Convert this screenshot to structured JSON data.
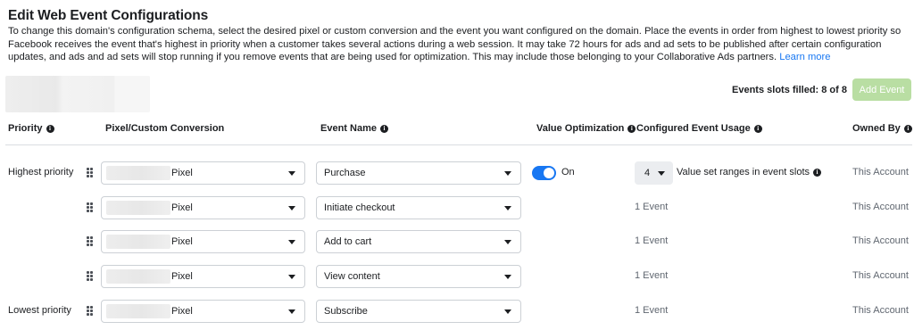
{
  "page": {
    "title": "Edit Web Event Configurations",
    "description": "To change this domain's configuration schema, select the desired pixel or custom conversion and the event you want configured on the domain. Place the events in order from highest to lowest priority so Facebook receives the event that's highest in priority when a customer takes several actions during a web session. It may take 72 hours for ads and ad sets to be published after certain configuration updates, and ads and ad sets will stop running if you remove events that are being used for optimization. This may include those belonging to your Collaborative Ads partners.",
    "learn_more": "Learn more"
  },
  "toolbar": {
    "slots_text": "Events slots filled: 8 of 8",
    "add_event_label": "Add Event",
    "add_event_color": "#b9dea3"
  },
  "table": {
    "headers": {
      "priority": "Priority",
      "pixel": "Pixel/Custom Conversion",
      "event_name": "Event Name",
      "value_optimization": "Value Optimization",
      "configured_usage": "Configured Event Usage",
      "owned_by": "Owned By"
    },
    "rows": [
      {
        "priority_label": "Highest priority",
        "pixel": "Pixel",
        "event": "Purchase",
        "value_opt": "On",
        "usage_count": "4",
        "usage_text": "Value set ranges in event slots",
        "owner": "This Account"
      },
      {
        "priority_label": "",
        "pixel": "Pixel",
        "event": "Initiate checkout",
        "usage_text": "1 Event",
        "owner": "This Account"
      },
      {
        "priority_label": "",
        "pixel": "Pixel",
        "event": "Add to cart",
        "usage_text": "1 Event",
        "owner": "This Account"
      },
      {
        "priority_label": "",
        "pixel": "Pixel",
        "event": "View content",
        "usage_text": "1 Event",
        "owner": "This Account"
      },
      {
        "priority_label": "Lowest priority",
        "pixel": "Pixel",
        "event": "Subscribe",
        "usage_text": "1 Event",
        "owner": "This Account"
      }
    ]
  },
  "colors": {
    "accent": "#1877f2",
    "toggle_on": "#1877f2",
    "muted_text": "#606770"
  }
}
